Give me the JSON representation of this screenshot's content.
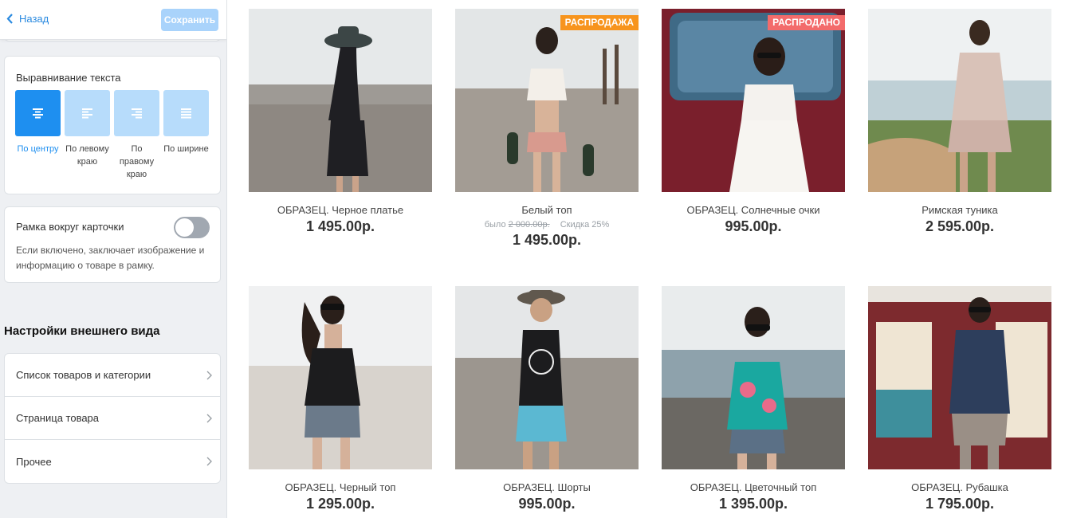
{
  "topbar": {
    "back_label": "Назад",
    "save_label": "Сохранить"
  },
  "text_align": {
    "title": "Выравнивание текста",
    "options": [
      {
        "label": "По центру",
        "icon": "align-center-icon",
        "active": true
      },
      {
        "label": "По левому краю",
        "icon": "align-left-icon",
        "active": false
      },
      {
        "label": "По правому краю",
        "icon": "align-right-icon",
        "active": false
      },
      {
        "label": "По ширине",
        "icon": "align-justify-icon",
        "active": false
      }
    ]
  },
  "card_frame": {
    "title": "Рамка вокруг карточки",
    "enabled": false,
    "description": "Если включено, заключает изображение и информацию о товаре в рамку."
  },
  "appearance": {
    "title": "Настройки внешнего вида",
    "items": [
      {
        "label": "Список товаров и категории"
      },
      {
        "label": "Страница товара"
      },
      {
        "label": "Прочее"
      }
    ]
  },
  "colors": {
    "accent": "#1e8ff0",
    "accent_light": "#b7dcfb",
    "badge_sale": "#f7941d",
    "badge_soldout": "#f36b6b"
  },
  "products": [
    {
      "name": "ОБРАЗЕЦ. Черное платье",
      "price": "1 495.00р."
    },
    {
      "name": "Белый топ",
      "price": "1 495.00р.",
      "badge": "РАСПРОДАЖА",
      "old_prefix": "было",
      "old_price": "2 000.00р.",
      "discount": "Скидка 25%"
    },
    {
      "name": "ОБРАЗЕЦ. Солнечные очки",
      "price": "995.00р.",
      "badge": "РАСПРОДАНО"
    },
    {
      "name": "Римская туника",
      "price": "2 595.00р."
    },
    {
      "name": "ОБРАЗЕЦ. Черный топ",
      "price": "1 295.00р."
    },
    {
      "name": "ОБРАЗЕЦ. Шорты",
      "price": "995.00р."
    },
    {
      "name": "ОБРАЗЕЦ. Цветочный топ",
      "price": "1 395.00р."
    },
    {
      "name": "ОБРАЗЕЦ. Рубашка",
      "price": "1 795.00р."
    }
  ]
}
